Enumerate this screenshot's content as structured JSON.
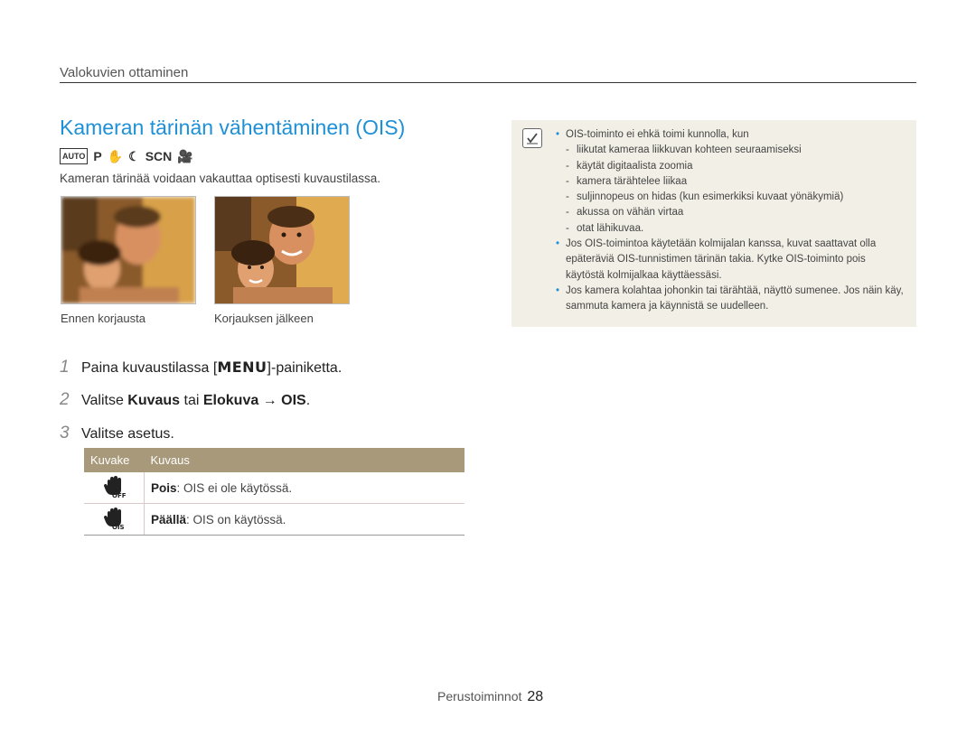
{
  "section_header": "Valokuvien ottaminen",
  "title": "Kameran tärinän vähentäminen (OIS)",
  "mode_icons": [
    "AUTO",
    "P",
    "✋",
    "☾",
    "SCN",
    "🎥"
  ],
  "intro": "Kameran tärinää voidaan vakauttaa optisesti kuvaustilassa.",
  "photos": {
    "before_caption": "Ennen korjausta",
    "after_caption": "Korjauksen jälkeen"
  },
  "steps": {
    "s1": {
      "num": "1",
      "pre": "Paina kuvaustilassa [",
      "key": "MENU",
      "post": "]-painiketta."
    },
    "s2": {
      "num": "2",
      "pre": "Valitse ",
      "b1": "Kuvaus",
      "mid": " tai ",
      "b2": "Elokuva",
      "arrow": " → ",
      "b3": "OIS",
      "post": "."
    },
    "s3": {
      "num": "3",
      "text": "Valitse asetus."
    }
  },
  "table": {
    "col_icon": "Kuvake",
    "col_desc": "Kuvaus",
    "rows": [
      {
        "icon": "ois-off-icon",
        "name": "Pois",
        "desc": ": OIS ei ole käytössä."
      },
      {
        "icon": "ois-on-icon",
        "name": "Päällä",
        "desc": ": OIS on käytössä."
      }
    ]
  },
  "note": {
    "b1": "OIS-toiminto ei ehkä toimi kunnolla, kun",
    "dashes": [
      "liikutat kameraa liikkuvan kohteen seuraamiseksi",
      "käytät digitaalista zoomia",
      "kamera tärähtelee liikaa",
      "suljinnopeus on hidas (kun esimerkiksi kuvaat yönäkymiä)",
      "akussa on vähän virtaa",
      "otat lähikuvaa."
    ],
    "b2": "Jos OIS-toimintoa käytetään kolmijalan kanssa, kuvat saattavat olla epäteräviä OIS-tunnistimen tärinän takia. Kytke OIS-toiminto pois käytöstä kolmijalkaa käyttäessäsi.",
    "b3": "Jos kamera kolahtaa johonkin tai tärähtää, näyttö sumenee. Jos näin käy, sammuta kamera ja käynnistä se uudelleen."
  },
  "footer": {
    "label": "Perustoiminnot",
    "page": "28"
  },
  "colors": {
    "accent": "#1e90d6",
    "table_header": "#a8997a",
    "note_bg": "#f2efe6"
  }
}
